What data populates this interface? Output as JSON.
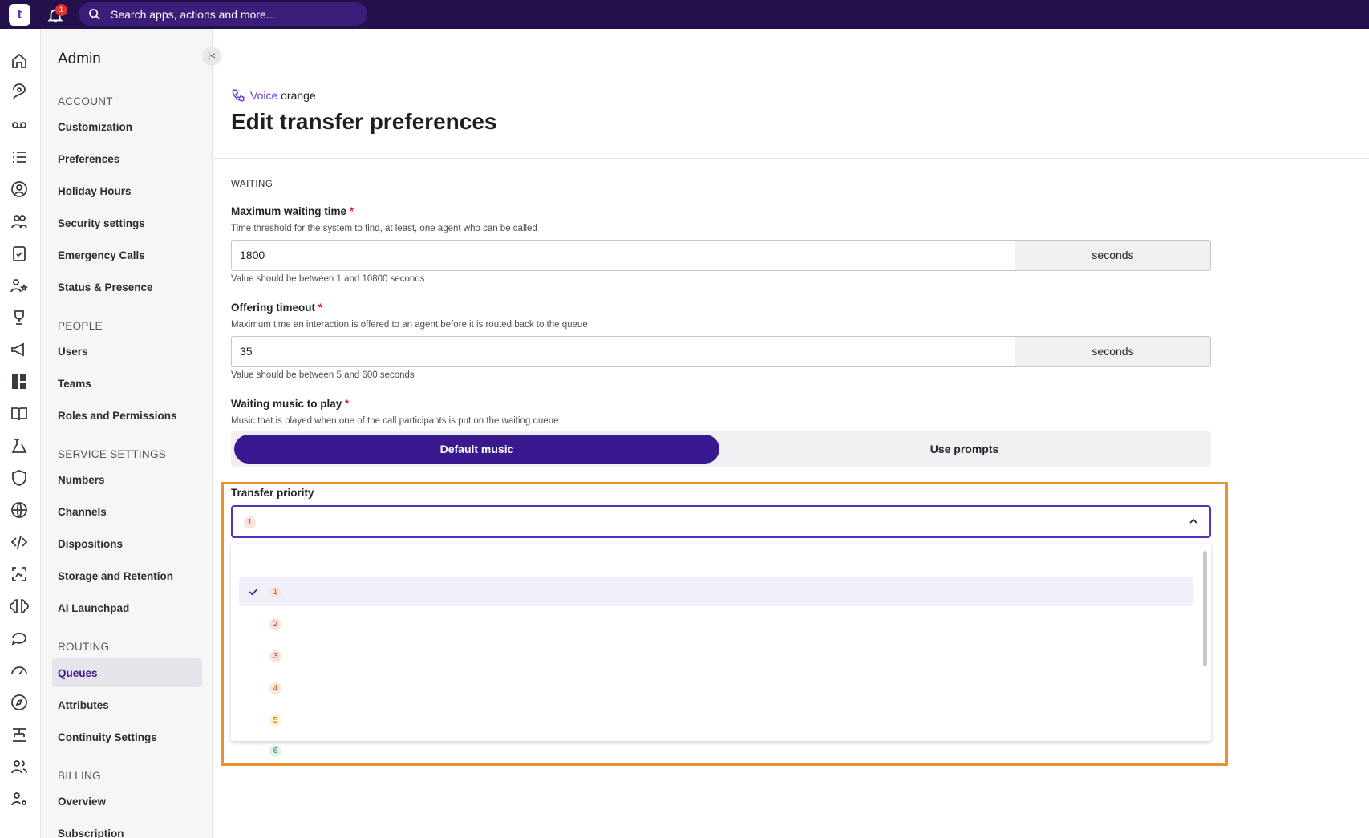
{
  "topbar": {
    "logo": "t",
    "notifications": "1",
    "search_placeholder": "Search apps, actions and more..."
  },
  "sidebar": {
    "title": "Admin",
    "sections": [
      {
        "title": "ACCOUNT",
        "items": [
          "Customization",
          "Preferences",
          "Holiday Hours",
          "Security settings",
          "Emergency Calls",
          "Status & Presence"
        ]
      },
      {
        "title": "PEOPLE",
        "items": [
          "Users",
          "Teams",
          "Roles and Permissions"
        ]
      },
      {
        "title": "SERVICE SETTINGS",
        "items": [
          "Numbers",
          "Channels",
          "Dispositions",
          "Storage and Retention",
          "AI Launchpad"
        ]
      },
      {
        "title": "ROUTING",
        "items": [
          "Queues",
          "Attributes",
          "Continuity Settings"
        ]
      },
      {
        "title": "BILLING",
        "items": [
          "Overview",
          "Subscription"
        ]
      }
    ],
    "active_item": "Queues"
  },
  "page": {
    "breadcrumb_link": "Voice",
    "breadcrumb_rest": "orange",
    "title": "Edit transfer preferences"
  },
  "form": {
    "section": "WAITING",
    "max_wait": {
      "label": "Maximum waiting time",
      "required": "*",
      "help": "Time threshold for the system to find, at least, one agent who can be called",
      "value": "1800",
      "unit": "seconds",
      "hint": "Value should be between 1 and 10800 seconds"
    },
    "offering_timeout": {
      "label": "Offering timeout",
      "required": "*",
      "help": "Maximum time an interaction is offered to an agent before it is routed back to the queue",
      "value": "35",
      "unit": "seconds",
      "hint": "Value should be between 5 and 600 seconds"
    },
    "waiting_music": {
      "label": "Waiting music to play",
      "required": "*",
      "help": "Music that is played when one of the call participants is put on the waiting queue",
      "option_on": "Default music",
      "option_off": "Use prompts"
    },
    "transfer_priority": {
      "label": "Transfer priority",
      "selected": "1",
      "options": [
        {
          "value": "1",
          "bg": "#fde3df",
          "fg": "#c0392b"
        },
        {
          "value": "2",
          "bg": "#fde3df",
          "fg": "#c0392b"
        },
        {
          "value": "3",
          "bg": "#fde3df",
          "fg": "#c0392b"
        },
        {
          "value": "4",
          "bg": "#fde8d9",
          "fg": "#c2561e"
        },
        {
          "value": "5",
          "bg": "#fdf2c9",
          "fg": "#8a6d00"
        },
        {
          "value": "6",
          "bg": "#dff3e4",
          "fg": "#2e7d45"
        }
      ]
    }
  },
  "colors": {
    "brand": "#3a1890",
    "topbar": "#24104a",
    "highlight": "#e8922c"
  }
}
